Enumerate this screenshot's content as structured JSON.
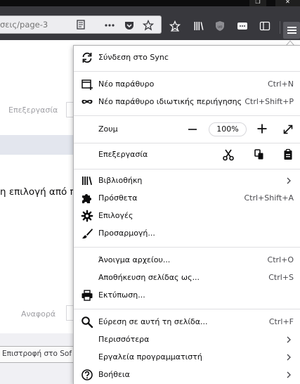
{
  "browser": {
    "url_fragment": "σεις/page-3",
    "window_controls": {
      "restore": "❐",
      "close": "✕"
    }
  },
  "background_page": {
    "label_edit": "Επεξεργασία",
    "body_text": "η επιλογή από πα",
    "label_report": "Αναφορά",
    "footer_button": "Επιστροφή στο Sof"
  },
  "menu": {
    "sync": {
      "label": "Σύνδεση στο Sync",
      "icon": "sync-icon"
    },
    "new_window": {
      "label": "Νέο παράθυρο",
      "shortcut": "Ctrl+N",
      "icon": "new-window-icon"
    },
    "new_private_window": {
      "label": "Νέο παράθυρο ιδιωτικής περιήγησης",
      "shortcut": "Ctrl+Shift+P",
      "icon": "private-mask-icon"
    },
    "zoom": {
      "label": "Ζουμ",
      "minus": "−",
      "value": "100%",
      "plus": "+"
    },
    "edit": {
      "label": "Επεξεργασία"
    },
    "library": {
      "label": "Βιβλιοθήκη",
      "icon": "library-icon"
    },
    "addons": {
      "label": "Πρόσθετα",
      "shortcut": "Ctrl+Shift+A",
      "icon": "puzzle-icon"
    },
    "options": {
      "label": "Επιλογές",
      "icon": "gear-icon"
    },
    "customize": {
      "label": "Προσαρμογή...",
      "icon": "paintbrush-icon"
    },
    "open_file": {
      "label": "Άνοιγμα αρχείου...",
      "shortcut": "Ctrl+O"
    },
    "save_page": {
      "label": "Αποθήκευση σελίδας ως...",
      "shortcut": "Ctrl+S"
    },
    "print": {
      "label": "Εκτύπωση...",
      "icon": "printer-icon"
    },
    "find": {
      "label": "Εύρεση σε αυτή τη σελίδα...",
      "shortcut": "Ctrl+F",
      "icon": "magnifier-icon"
    },
    "more": {
      "label": "Περισσότερα"
    },
    "web_developer": {
      "label": "Εργαλεία προγραμματιστή"
    },
    "help": {
      "label": "Βοήθεια",
      "icon": "help-icon"
    }
  },
  "colors": {
    "toolbar": "#38383d",
    "panel_bg": "#ffffff",
    "separator": "#dfdfe2",
    "text": "#0c0c0d"
  }
}
